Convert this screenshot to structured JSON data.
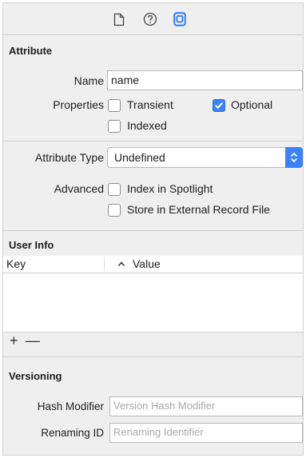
{
  "tabs": [
    {
      "icon": "file-inspector-icon"
    },
    {
      "icon": "help-inspector-icon"
    },
    {
      "icon": "data-model-inspector-icon",
      "selected": true
    }
  ],
  "attribute": {
    "header": "Attribute",
    "name_label": "Name",
    "name_value": "name",
    "properties_label": "Properties",
    "transient": {
      "label": "Transient",
      "checked": false
    },
    "optional": {
      "label": "Optional",
      "checked": true
    },
    "indexed": {
      "label": "Indexed",
      "checked": false
    },
    "type_label": "Attribute Type",
    "type_value": "Undefined",
    "advanced_label": "Advanced",
    "spotlight": {
      "label": "Index in Spotlight",
      "checked": false
    },
    "external": {
      "label": "Store in External Record File",
      "checked": false
    }
  },
  "user_info": {
    "header": "User Info",
    "columns": [
      "Key",
      "Value"
    ],
    "sort_indicator": "^",
    "rows": [],
    "add_label": "+",
    "remove_label": "—"
  },
  "versioning": {
    "header": "Versioning",
    "hash_label": "Hash Modifier",
    "hash_placeholder": "Version Hash Modifier",
    "renaming_label": "Renaming ID",
    "renaming_placeholder": "Renaming Identifier"
  },
  "colors": {
    "accent": "#3b82f6",
    "panel_bg": "#efefef"
  }
}
